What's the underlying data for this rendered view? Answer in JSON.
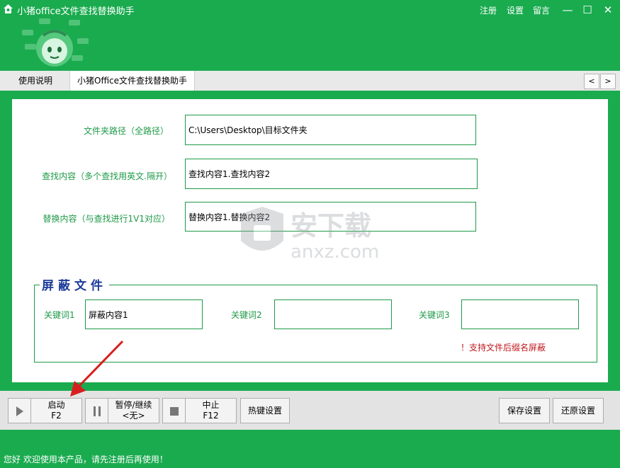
{
  "window": {
    "title": "小猪office文件查找替换助手",
    "links": [
      "注册",
      "设置",
      "留言"
    ],
    "controls": {
      "minimize": "—",
      "maximize": "☐",
      "close": "✕"
    }
  },
  "tabs": [
    {
      "label": "使用说明",
      "active": false
    },
    {
      "label": "小猪Office文件查找替换助手",
      "active": true
    }
  ],
  "tab_scroll": {
    "left": "<",
    "right": ">"
  },
  "form": {
    "folder_label": "文件夹路径（全路径）",
    "folder_value": "C:\\Users\\Desktop\\目标文件夹",
    "find_label": "查找内容（多个查找用英文.隔开）",
    "find_value": "查找内容1.查找内容2",
    "replace_label": "替换内容（与查找进行1V1对应）",
    "replace_value": "替换内容1.替换内容2"
  },
  "exclude": {
    "title": "屏蔽文件",
    "kw1_label": "关键词1",
    "kw1_value": "屏蔽内容1",
    "kw2_label": "关键词2",
    "kw2_value": "",
    "kw3_label": "关键词3",
    "kw3_value": "",
    "note": "！支持文件后缀名屏蔽"
  },
  "buttons": {
    "start_label": "启动",
    "start_key": "F2",
    "pause_label": "暂停/继续",
    "pause_key": "<无>",
    "stop_label": "中止",
    "stop_key": "F12",
    "hotkey_label": "热键设置",
    "save_label": "保存设置",
    "restore_label": "还原设置"
  },
  "status": "您好 欢迎使用本产品，请先注册后再使用！",
  "watermark": {
    "text": "安下载",
    "domain": "anxz.com"
  },
  "colors": {
    "brand_green": "#1aab4f",
    "label_green": "#1e9a48",
    "title_blue": "#1c3c9a",
    "note_red": "#c0191e"
  }
}
